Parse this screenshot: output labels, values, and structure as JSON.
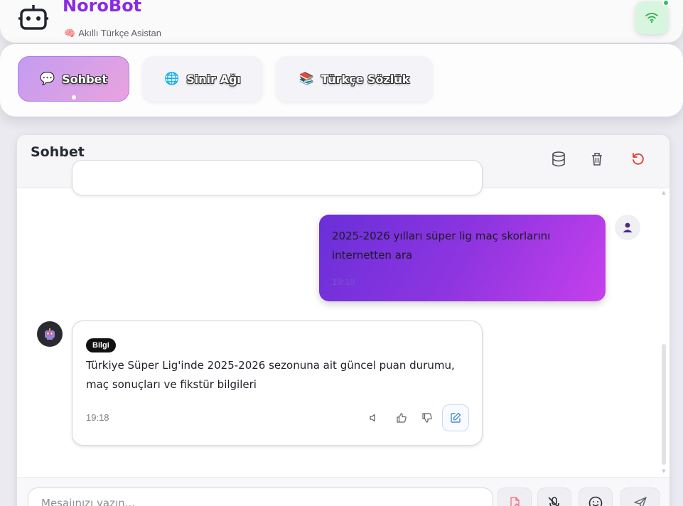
{
  "header": {
    "app_title": "NöroBot",
    "subtitle": "Akıllı Türkçe Asistan",
    "logo_icon": "robot-icon",
    "status_icon": "wifi-icon",
    "status_color": "#2ec05a"
  },
  "tabs": [
    {
      "label": "Sohbet",
      "icon": "💬",
      "active": true
    },
    {
      "label": "Sinir Ağı",
      "icon": "🌐",
      "active": false
    },
    {
      "label": "Türkçe Sözlük",
      "icon": "📚",
      "active": false
    }
  ],
  "chat": {
    "title": "Sohbet",
    "header_icons": [
      "database-icon",
      "trash-icon",
      "refresh-icon"
    ],
    "messages": [
      {
        "role": "user",
        "text": "2025-2026 yılları süper lig maç skorlarını internetten ara",
        "time": "19:18"
      },
      {
        "role": "bot",
        "badge": "Bilgi",
        "text": "Türkiye Süper Lig'inde 2025-2026 sezonuna ait güncel puan durumu, maç sonuçları ve fikstür bilgileri",
        "time": "19:18",
        "actions": [
          "speaker-icon",
          "thumbs-up-icon",
          "thumbs-down-icon",
          "edit-icon"
        ]
      }
    ]
  },
  "input": {
    "placeholder": "Mesajınızı yazın...",
    "value": "",
    "buttons": [
      "file-icon",
      "mic-off-icon",
      "emoji-icon",
      "send-icon"
    ]
  },
  "colors": {
    "accent": "#8a2be2",
    "user_bubble_start": "#6a2fd8",
    "user_bubble_end": "#c640ec",
    "refresh": "#e53935"
  }
}
